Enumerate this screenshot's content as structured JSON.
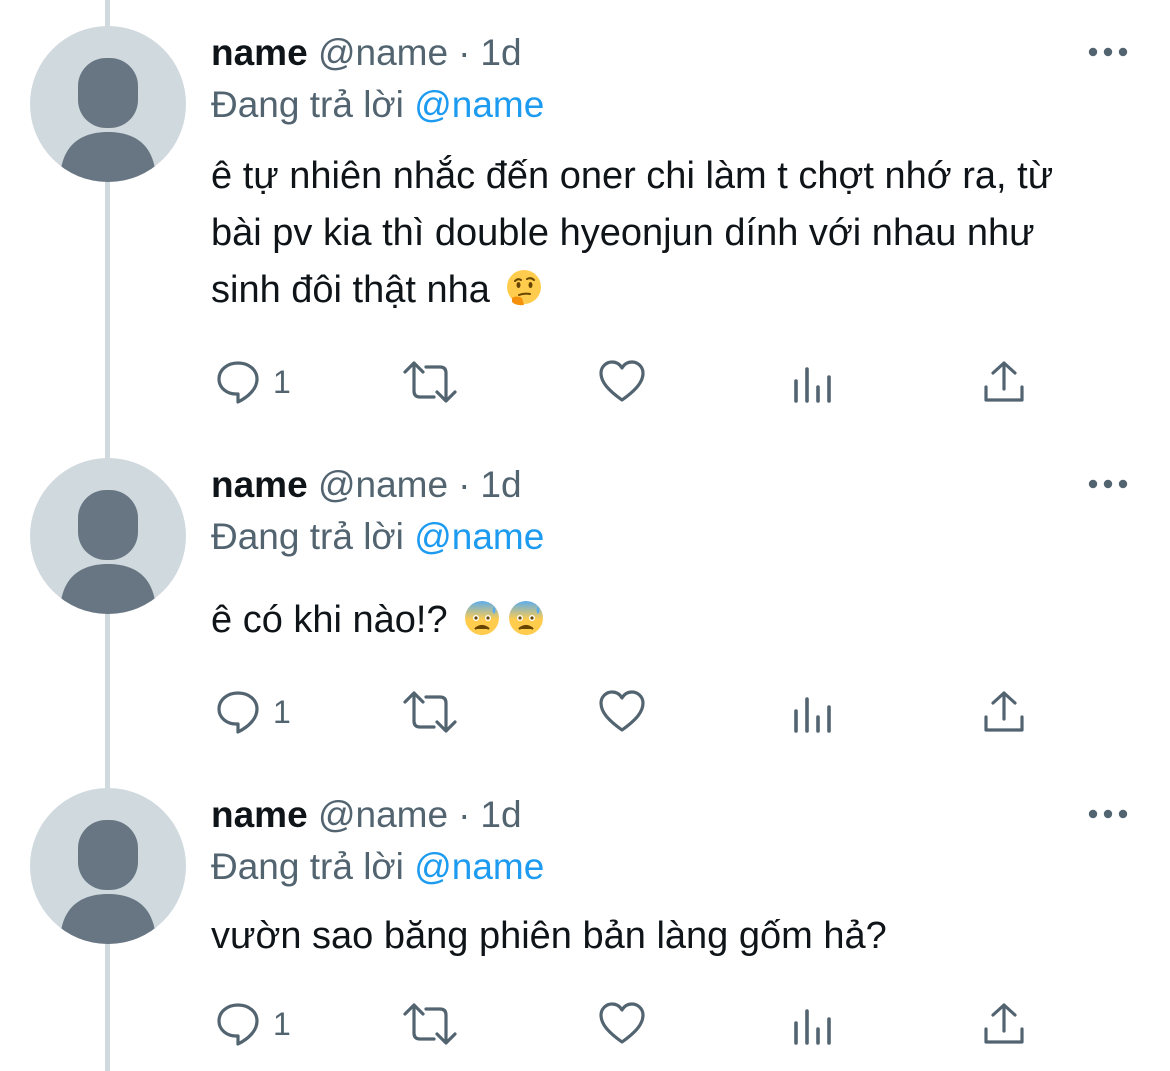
{
  "tweets": [
    {
      "name": "name",
      "handle": "@name",
      "separator": "·",
      "time": "1d",
      "reply_prefix": "Đang trả lời",
      "reply_to": "@name",
      "text": "ê tự nhiên nhắc đến oner chi làm t chợt nhớ ra, từ bài pv kia thì double hyeonjun dính với nhau như sinh đôi thật nha",
      "emojis": [
        "thinking-face"
      ],
      "reply_count": "1"
    },
    {
      "name": "name",
      "handle": "@name",
      "separator": "·",
      "time": "1d",
      "reply_prefix": "Đang trả lời",
      "reply_to": "@name",
      "text": "ê có khi nào!?",
      "emojis": [
        "anxious-face-with-sweat",
        "anxious-face-with-sweat"
      ],
      "reply_count": "1"
    },
    {
      "name": "name",
      "handle": "@name",
      "separator": "·",
      "time": "1d",
      "reply_prefix": "Đang trả lời",
      "reply_to": "@name",
      "text": "vườn sao băng phiên bản làng gốm hả?",
      "emojis": [],
      "reply_count": "1"
    }
  ],
  "icons": {
    "more": "more-horizontal-icon",
    "reply": "reply-bubble-icon",
    "retweet": "retweet-icon",
    "like": "heart-icon",
    "views": "bar-chart-icon",
    "share": "share-upload-icon"
  },
  "colors": {
    "text": "#0f1419",
    "secondary": "#536471",
    "link": "#1d9bf0",
    "thread_line": "#cfd9de",
    "avatar_bg": "#cfd9de",
    "avatar_fg": "#687684"
  }
}
